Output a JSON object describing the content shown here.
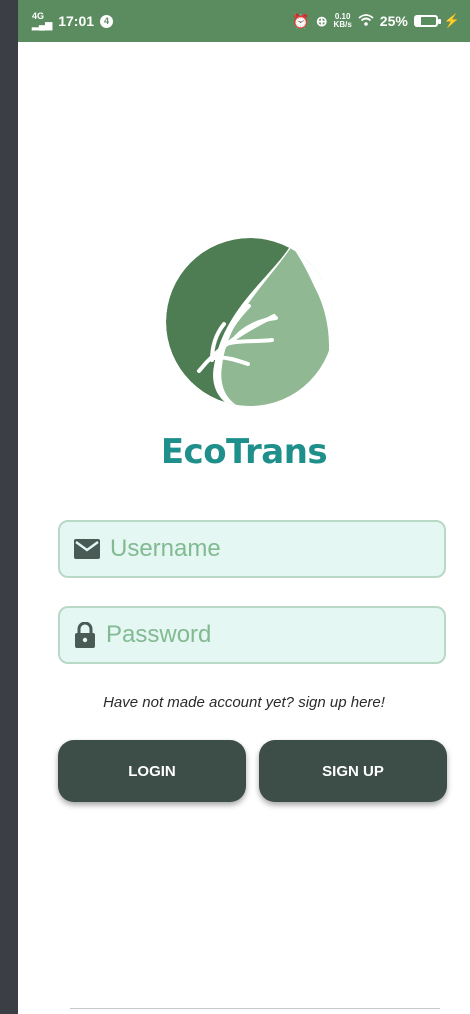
{
  "status_bar": {
    "network": "4G",
    "time": "17:01",
    "notification_count": "4",
    "speed_value": "0.10",
    "speed_unit": "KB/s",
    "battery": "25%"
  },
  "app": {
    "name": "EcoTrans"
  },
  "colors": {
    "status_bar": "#5b8c5f",
    "brand_teal": "#1f8f8c",
    "leaf_dark": "#4e7d53",
    "leaf_light": "#8fb893",
    "field_bg": "#e4f7f3",
    "button_bg": "#3d4d48"
  },
  "form": {
    "username": {
      "placeholder": "Username",
      "icon": "envelope-icon"
    },
    "password": {
      "placeholder": "Password",
      "icon": "lock-icon"
    },
    "signup_hint": "Have not made account yet? sign up here!",
    "login_label": "LOGIN",
    "signup_label": "SIGN UP"
  }
}
